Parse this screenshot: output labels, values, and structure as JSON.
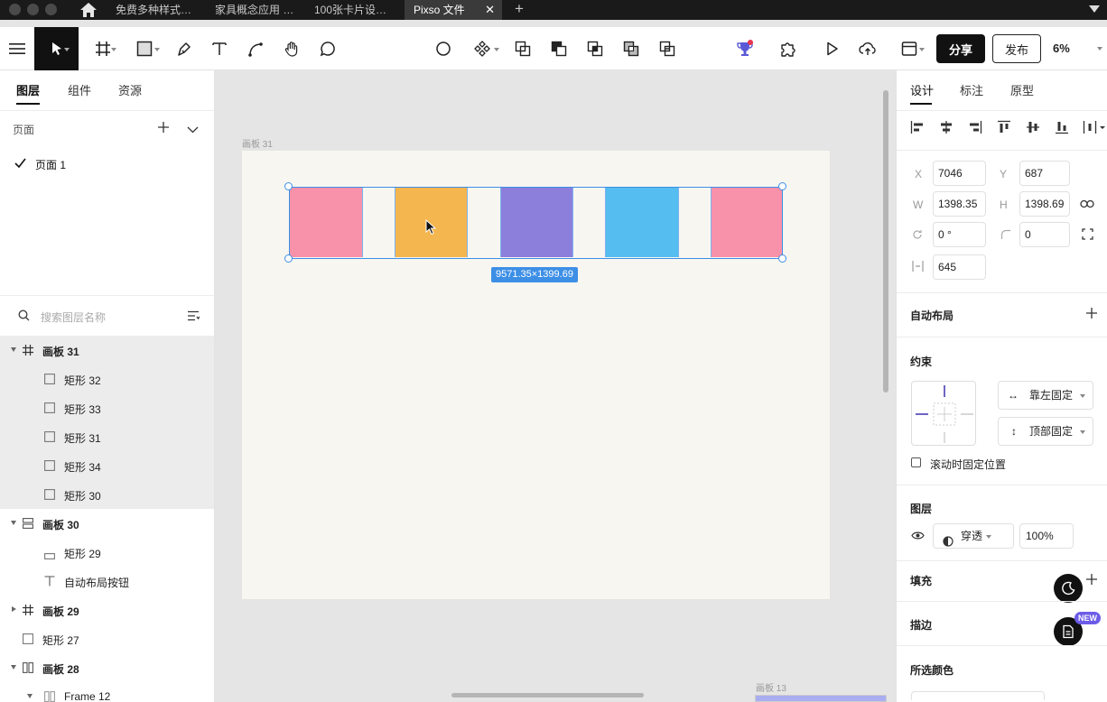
{
  "browser": {
    "tabs": [
      {
        "label": "免费多种样式…"
      },
      {
        "label": "家具概念应用 …"
      },
      {
        "label": "100张卡片设…"
      },
      {
        "label": "Pixso 文件"
      }
    ],
    "close_glyph": "✕",
    "plus_glyph": "+"
  },
  "toolbar": {
    "share_label": "分享",
    "publish_label": "发布",
    "zoom": "6%"
  },
  "left_panel": {
    "tabs": [
      "图层",
      "组件",
      "资源"
    ],
    "pages_label": "页面",
    "pages": [
      {
        "label": "页面 1"
      }
    ],
    "search_placeholder": "搜索图层名称",
    "layers": [
      {
        "label": "画板 31",
        "bold": true
      },
      {
        "label": "矩形 32"
      },
      {
        "label": "矩形 33"
      },
      {
        "label": "矩形 31"
      },
      {
        "label": "矩形 34"
      },
      {
        "label": "矩形 30"
      },
      {
        "label": "画板 30",
        "bold": true
      },
      {
        "label": "矩形 29"
      },
      {
        "label": "自动布局按钮"
      },
      {
        "label": "画板 29",
        "bold": true
      },
      {
        "label": "矩形 27"
      },
      {
        "label": "画板 28",
        "bold": true
      },
      {
        "label": "Frame 12"
      }
    ]
  },
  "canvas": {
    "frame_label": "画板 31",
    "frame13_label": "画板 13",
    "dimension_badge": "9571.35×1399.69",
    "rect_colors": [
      "#f891aa",
      "#f4b64e",
      "#8c7fdc",
      "#55bdf0",
      "#f891aa"
    ]
  },
  "right_panel": {
    "tabs": [
      "设计",
      "标注",
      "原型"
    ],
    "x_label": "X",
    "x_value": "7046",
    "y_label": "Y",
    "y_value": "687",
    "w_label": "W",
    "w_value": "1398.35",
    "h_label": "H",
    "h_value": "1398.69",
    "rotation_value": "0 °",
    "radius_value": "0",
    "spacing_value": "645",
    "auto_layout_title": "自动布局",
    "constraints_title": "约束",
    "constraint_h": "靠左固定",
    "constraint_v": "顶部固定",
    "fix_on_scroll_label": "滚动时固定位置",
    "layer_title": "图层",
    "blend_mode": "穿透",
    "opacity": "100%",
    "fill_title": "填充",
    "stroke_title": "描边",
    "selected_colors_title": "所选颜色",
    "new_badge": "NEW"
  }
}
